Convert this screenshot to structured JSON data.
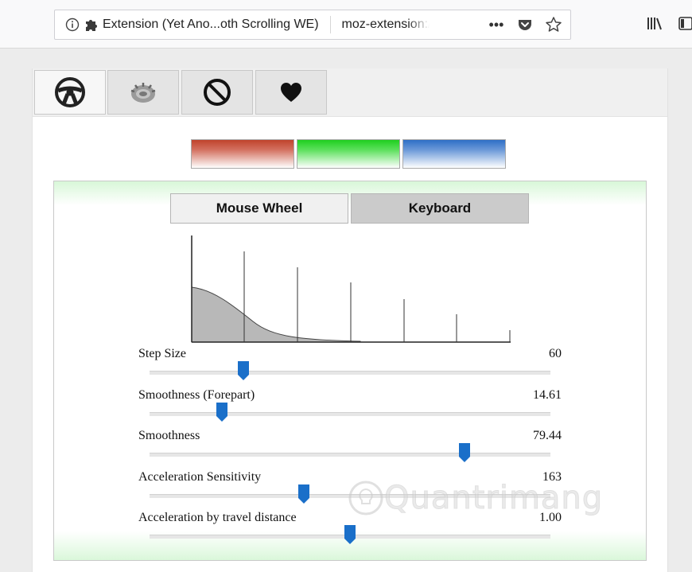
{
  "browser": {
    "identity_label": "Extension (Yet Ano...oth Scrolling WE)",
    "url_text": "moz-extension://",
    "more_label": "•••"
  },
  "tabs": [
    {
      "icon": "steering-wheel-icon"
    },
    {
      "icon": "gear-icon"
    },
    {
      "icon": "blocked-icon"
    },
    {
      "icon": "heart-icon"
    }
  ],
  "themes": [
    "red",
    "green",
    "blue"
  ],
  "modes": {
    "mouse_label": "Mouse Wheel",
    "keyboard_label": "Keyboard"
  },
  "sliders": [
    {
      "label": "Step Size",
      "value": "60",
      "fraction": 0.235
    },
    {
      "label": "Smoothness (Forepart)",
      "value": "14.61",
      "fraction": 0.18
    },
    {
      "label": "Smoothness",
      "value": "79.44",
      "fraction": 0.785
    },
    {
      "label": "Acceleration Sensitivity",
      "value": "163",
      "fraction": 0.385
    },
    {
      "label": "Acceleration by travel distance",
      "value": "1.00",
      "fraction": 0.5
    }
  ],
  "colors": {
    "thumb": "#1a6fc9",
    "accent_green": "#d8f7d8"
  },
  "watermark": "Quantrimang"
}
